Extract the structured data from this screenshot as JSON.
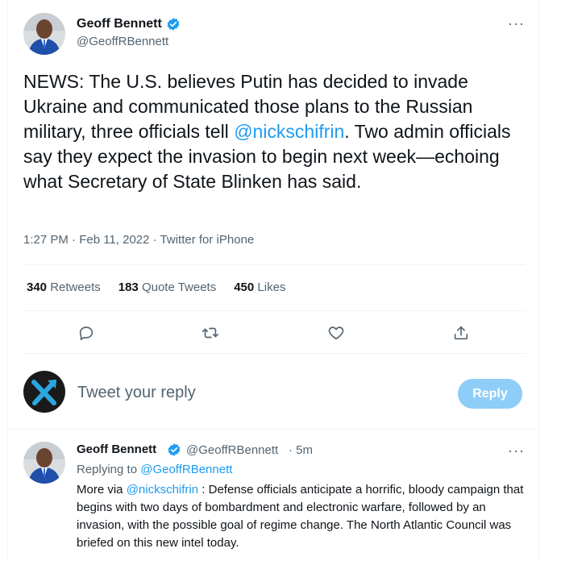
{
  "main_tweet": {
    "author_name": "Geoff Bennett",
    "author_handle": "@GeoffRBennett",
    "more_label": "···",
    "text_parts": {
      "before": "NEWS: The U.S. believes Putin has decided to invade Ukraine and communicated those plans to the Russian military, three officials tell ",
      "mention": "@nickschifrin",
      "after": ". Two admin officials say they expect the invasion to begin next week—echoing what Secretary of State Blinken has said."
    },
    "meta": "1:27 PM · Feb 11, 2022 · Twitter for iPhone",
    "stats": {
      "retweets_count": "340",
      "retweets_label": "Retweets",
      "quotes_count": "183",
      "quotes_label": "Quote Tweets",
      "likes_count": "450",
      "likes_label": "Likes"
    },
    "actions": [
      "reply-icon",
      "retweet-icon",
      "like-icon",
      "share-icon"
    ]
  },
  "composer": {
    "placeholder": "Tweet your reply",
    "button_label": "Reply"
  },
  "reply_tweet": {
    "author_name": "Geoff Bennett",
    "author_handle": "@GeoffRBennett",
    "time": "· 5m",
    "more_label": "···",
    "replying_prefix": "Replying to ",
    "replying_handle": "@GeoffRBennett",
    "text_parts": {
      "before": "More via ",
      "mention": "@nickschifrin",
      "after": " : Defense officials anticipate a horrific, bloody campaign that begins with two days of bombardment and electronic warfare, followed by an invasion, with the possible goal of regime change. The North Atlantic Council was briefed on this new intel today."
    }
  },
  "colors": {
    "accent": "#1d9bf0",
    "reply_button": "#8ecdf8",
    "secondary_text": "#536471"
  }
}
